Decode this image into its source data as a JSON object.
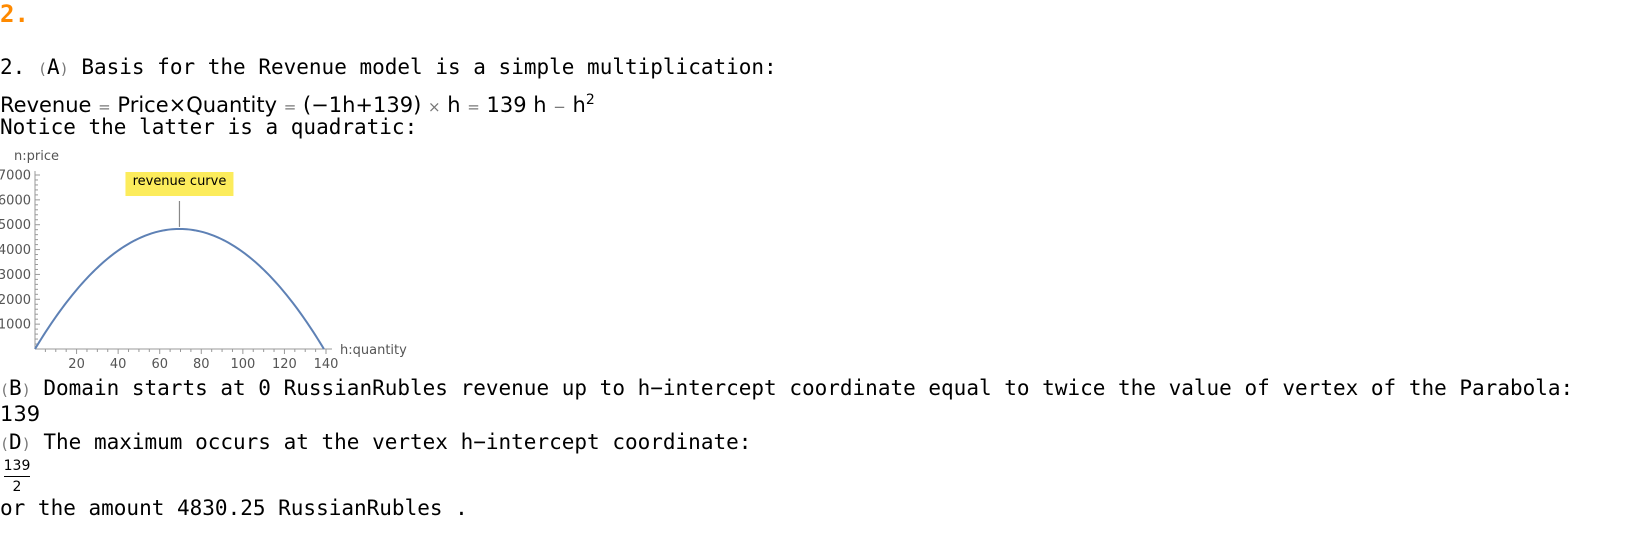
{
  "heading": "2.",
  "part_a": {
    "prefix": "2.",
    "label": "A",
    "text": "Basis for the Revenue model is a simple multiplication:"
  },
  "formula": {
    "lhs": "Revenue",
    "eq1": "=",
    "product": "Price×Quantity",
    "eq2": "=",
    "factor": "(−1h+139)",
    "times": "×",
    "var": "h",
    "eq3": "=",
    "result_a": "139 h",
    "minus": "−",
    "result_b": "h",
    "exponent": "2"
  },
  "notice_text": "Notice the latter is a quadratic:",
  "chart_data": {
    "type": "line",
    "xlabel": "h:quantity",
    "ylabel": "n:price",
    "xlim": [
      0,
      140
    ],
    "ylim": [
      0,
      7000
    ],
    "xticks": [
      20,
      40,
      60,
      80,
      100,
      120,
      140
    ],
    "yticks": [
      1000,
      2000,
      3000,
      4000,
      5000,
      6000,
      7000
    ],
    "function": "139h - h^2",
    "x": [
      0,
      10,
      20,
      30,
      40,
      50,
      60,
      69.5,
      80,
      90,
      100,
      110,
      120,
      130,
      139
    ],
    "values": [
      0,
      1290,
      2380,
      3270,
      3960,
      4450,
      4740,
      4830.25,
      4720,
      4410,
      3900,
      3190,
      2280,
      1170,
      0
    ],
    "annotation": {
      "text": "revenue curve",
      "x": 69.5,
      "y": 4830.25,
      "color": "#fcec5c"
    },
    "line_color": "#5e81b5"
  },
  "part_b": {
    "label": "B",
    "text": "Domain starts at 0 RussianRubles revenue up to h−intercept coordinate equal to twice the value of vertex of the Parabola:",
    "value": "139"
  },
  "part_d": {
    "label": "D",
    "text": "The maximum occurs at the vertex h−intercept coordinate:",
    "frac_num": "139",
    "frac_den": "2",
    "closing": "or the amount 4830.25 RussianRubles ."
  }
}
